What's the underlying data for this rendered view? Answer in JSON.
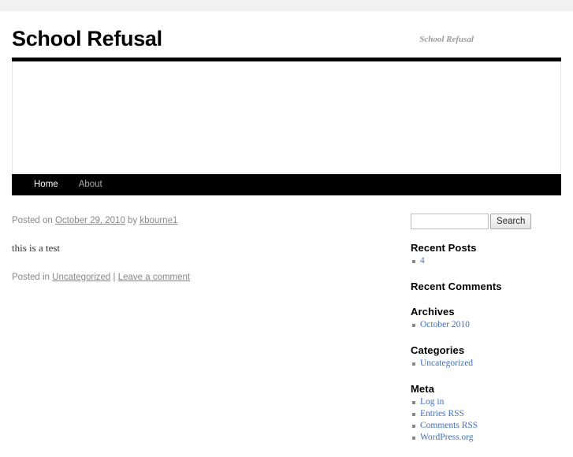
{
  "site": {
    "title": "School Refusal",
    "description": "School Refusal"
  },
  "nav": {
    "items": [
      {
        "label": "Home",
        "current": true
      },
      {
        "label": "About",
        "current": false
      }
    ]
  },
  "post": {
    "meta": {
      "posted_on_prefix": "Posted on ",
      "date": "October 29, 2010",
      "by_text": " by ",
      "author": "kbourne1"
    },
    "content": "this is a test",
    "utility": {
      "posted_in_prefix": "Posted in ",
      "category": "Uncategorized",
      "separator": " | ",
      "comments_link": "Leave a comment"
    }
  },
  "sidebar": {
    "search": {
      "value": "",
      "placeholder": "",
      "button_label": "Search"
    },
    "widgets": [
      {
        "title": "Recent Posts",
        "items": [
          "4"
        ]
      },
      {
        "title": "Recent Comments",
        "items": []
      },
      {
        "title": "Archives",
        "items": [
          "October 2010"
        ]
      },
      {
        "title": "Categories",
        "items": [
          "Uncategorized"
        ]
      },
      {
        "title": "Meta",
        "items": [
          "Log in",
          "Entries RSS",
          "Comments RSS",
          "WordPress.org"
        ]
      }
    ]
  },
  "colors": {
    "link": "#3b6fd4",
    "meta_text": "#888888",
    "nav_background": "#000000",
    "nav_active": "#ffffff",
    "nav_inactive": "#aaaaaa",
    "top_strip": "#f1f1f1"
  }
}
